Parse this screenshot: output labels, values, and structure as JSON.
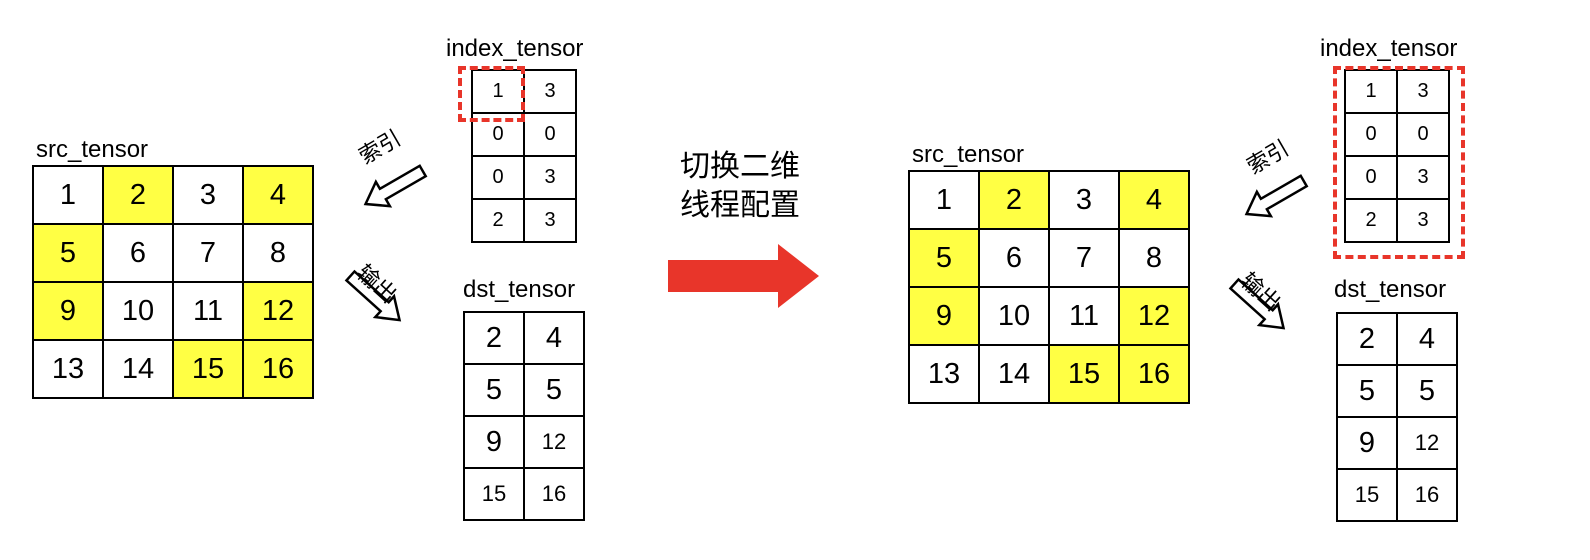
{
  "left": {
    "src_label": "src_tensor",
    "index_label": "index_tensor",
    "dst_label": "dst_tensor",
    "index_action": "索引",
    "output_action": "输出",
    "src": [
      [
        {
          "v": "1",
          "hl": false
        },
        {
          "v": "2",
          "hl": true
        },
        {
          "v": "3",
          "hl": false
        },
        {
          "v": "4",
          "hl": true
        }
      ],
      [
        {
          "v": "5",
          "hl": true
        },
        {
          "v": "6",
          "hl": false
        },
        {
          "v": "7",
          "hl": false
        },
        {
          "v": "8",
          "hl": false
        }
      ],
      [
        {
          "v": "9",
          "hl": true
        },
        {
          "v": "10",
          "hl": false
        },
        {
          "v": "11",
          "hl": false
        },
        {
          "v": "12",
          "hl": true
        }
      ],
      [
        {
          "v": "13",
          "hl": false
        },
        {
          "v": "14",
          "hl": false
        },
        {
          "v": "15",
          "hl": true
        },
        {
          "v": "16",
          "hl": true
        }
      ]
    ],
    "index": [
      [
        "1",
        "3"
      ],
      [
        "0",
        "0"
      ],
      [
        "0",
        "3"
      ],
      [
        "2",
        "3"
      ]
    ],
    "dst": [
      [
        "2",
        "4"
      ],
      [
        "5",
        "5"
      ],
      [
        "9",
        "12"
      ],
      [
        "15",
        "16"
      ]
    ]
  },
  "middle": {
    "line1": "切换二维",
    "line2": "线程配置",
    "arrow_color": "#e8352a"
  },
  "right": {
    "src_label": "src_tensor",
    "index_label": "index_tensor",
    "dst_label": "dst_tensor",
    "index_action": "索引",
    "output_action": "输出",
    "src": [
      [
        {
          "v": "1",
          "hl": false
        },
        {
          "v": "2",
          "hl": true
        },
        {
          "v": "3",
          "hl": false
        },
        {
          "v": "4",
          "hl": true
        }
      ],
      [
        {
          "v": "5",
          "hl": true
        },
        {
          "v": "6",
          "hl": false
        },
        {
          "v": "7",
          "hl": false
        },
        {
          "v": "8",
          "hl": false
        }
      ],
      [
        {
          "v": "9",
          "hl": true
        },
        {
          "v": "10",
          "hl": false
        },
        {
          "v": "11",
          "hl": false
        },
        {
          "v": "12",
          "hl": true
        }
      ],
      [
        {
          "v": "13",
          "hl": false
        },
        {
          "v": "14",
          "hl": false
        },
        {
          "v": "15",
          "hl": true
        },
        {
          "v": "16",
          "hl": true
        }
      ]
    ],
    "index": [
      [
        "1",
        "3"
      ],
      [
        "0",
        "0"
      ],
      [
        "0",
        "3"
      ],
      [
        "2",
        "3"
      ]
    ],
    "dst": [
      [
        "2",
        "4"
      ],
      [
        "5",
        "5"
      ],
      [
        "9",
        "12"
      ],
      [
        "15",
        "16"
      ]
    ]
  },
  "colors": {
    "highlight": "#ffff44",
    "dashed_box": "#e8352a",
    "grid_line": "#000000"
  }
}
